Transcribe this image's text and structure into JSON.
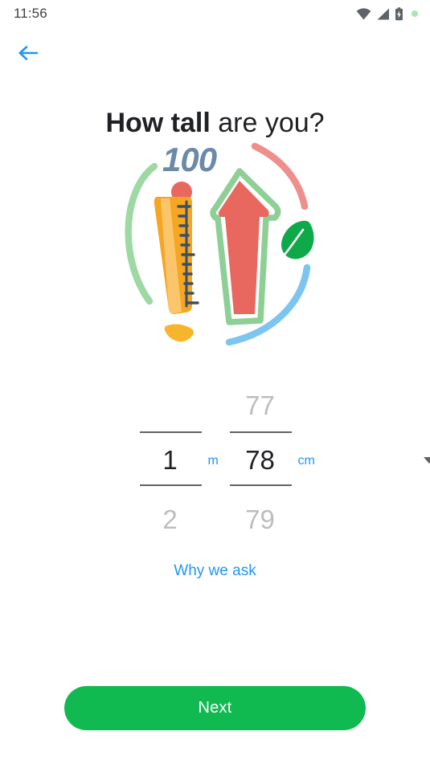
{
  "status_bar": {
    "time": "11:56",
    "icons": [
      "wifi-icon",
      "signal-icon",
      "battery-charging-icon",
      "recording-dot-icon"
    ]
  },
  "nav": {
    "back_label": "back-arrow-icon",
    "back_color": "#2196f3"
  },
  "header": {
    "title_strong": "How tall",
    "title_rest": " are you?"
  },
  "illustration": {
    "name": "height-measure-illustration",
    "badge_number": "100",
    "colors": {
      "arc_green": "#9ed9a4",
      "arc_salmon": "#ee8f8c",
      "arc_blue": "#7bc5f0",
      "ruler_orange": "#f5a623",
      "ruler_light": "#fbc66b",
      "tick_navy": "#3a5068",
      "arrow_red": "#e8675f",
      "arrow_outline_green": "#8ecf96",
      "leaf_green": "#0fa94a",
      "number_slate": "#6b8aa8",
      "dot_red": "#e8675f",
      "shape_yellow": "#f6b62c"
    }
  },
  "picker": {
    "meters": {
      "above": "",
      "value": "1",
      "below": "2",
      "unit": "m"
    },
    "centimeters": {
      "above": "77",
      "value": "78",
      "below": "79",
      "unit": "cm"
    },
    "unit_caret": "chevron-down-icon",
    "unit_color": "#2196f3"
  },
  "links": {
    "why_we_ask": "Why we ask"
  },
  "actions": {
    "next_label": "Next",
    "next_color": "#10ba51"
  }
}
